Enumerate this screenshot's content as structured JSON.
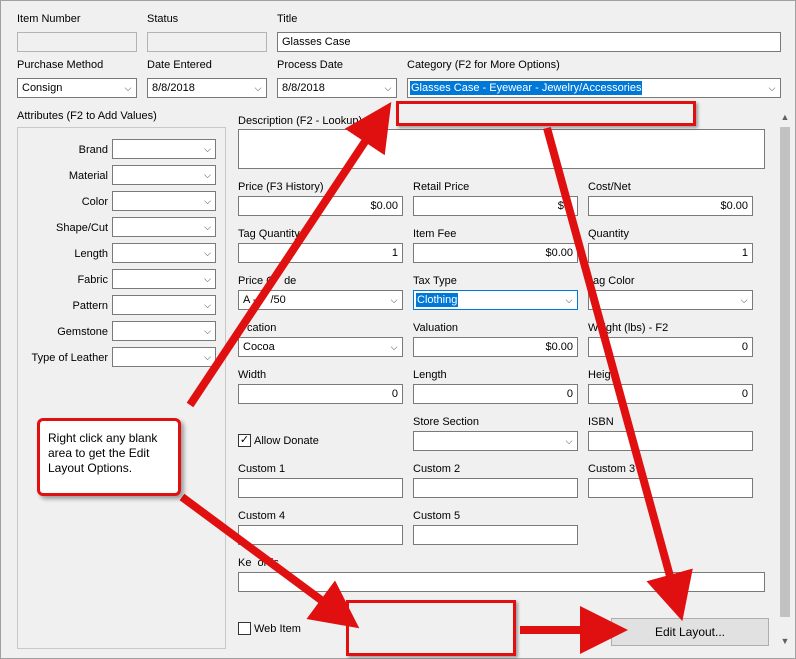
{
  "header": {
    "item_number_label": "Item Number",
    "status_label": "Status",
    "title_label": "Title",
    "title_value": "Glasses Case",
    "purchase_method_label": "Purchase Method",
    "purchase_method_value": "Consign",
    "date_entered_label": "Date Entered",
    "date_entered_value": "8/8/2018",
    "process_date_label": "Process Date",
    "process_date_value": "8/8/2018",
    "category_label": "Category (F2 for More Options)",
    "category_value": "Glasses Case - Eyewear - Jewelry/Accessories"
  },
  "attributes": {
    "label": "Attributes (F2 to Add Values)",
    "items": [
      "Brand",
      "Material",
      "Color",
      "Shape/Cut",
      "Length",
      "Fabric",
      "Pattern",
      "Gemstone",
      "Type of Leather"
    ]
  },
  "details": {
    "description_label": "Description (F2 - Lookup)",
    "price_label": "Price (F3 History)",
    "price_value": "$0.00",
    "retail_price_label": "Retail Price",
    "retail_price_value": "$0.",
    "cost_net_label": "Cost/Net",
    "cost_net_value": "$0.00",
    "tag_quantity_label": "Tag Quantity",
    "tag_quantity_value": "1",
    "item_fee_label": "Item Fee",
    "item_fee_value": "$0.00",
    "quantity_label": "Quantity",
    "quantity_value": "1",
    "price_code_label": "Price C",
    "price_code_label_end": "de",
    "price_code_value": "A -",
    "price_code_value_end": "/50",
    "tax_type_label": "Tax Type",
    "tax_type_value": "Clothing",
    "tag_color_label": "ag Color",
    "location_label": "cation",
    "location_value": "Cocoa",
    "valuation_label": "Valuation",
    "valuation_value": "$0.00",
    "weight_label": "W",
    "weight_label_end": "ight (lbs) - F2",
    "weight_value": "0",
    "width_label": "Width",
    "width_value": "0",
    "length_label": "Length",
    "length_value": "0",
    "height_label": "Heig",
    "height_value": "0",
    "allow_donate_label": "Allow Donate",
    "store_section_label": "Store Section",
    "isbn_label": "ISBN",
    "custom1_label": "Custom 1",
    "custom2_label": "Custom 2",
    "custom3_label": "Custom 3",
    "custom4_label": "Custom 4",
    "custom5_label": "Custom 5",
    "keywords_label_start": "Ke",
    "keywords_label_end": "ords",
    "web_item_label": "Web Item",
    "edit_layout_label": "Edit Layout..."
  },
  "annotation": {
    "callout_text": "Right click any blank area to get the Edit Layout Options.",
    "accent_color": "#e01010"
  }
}
